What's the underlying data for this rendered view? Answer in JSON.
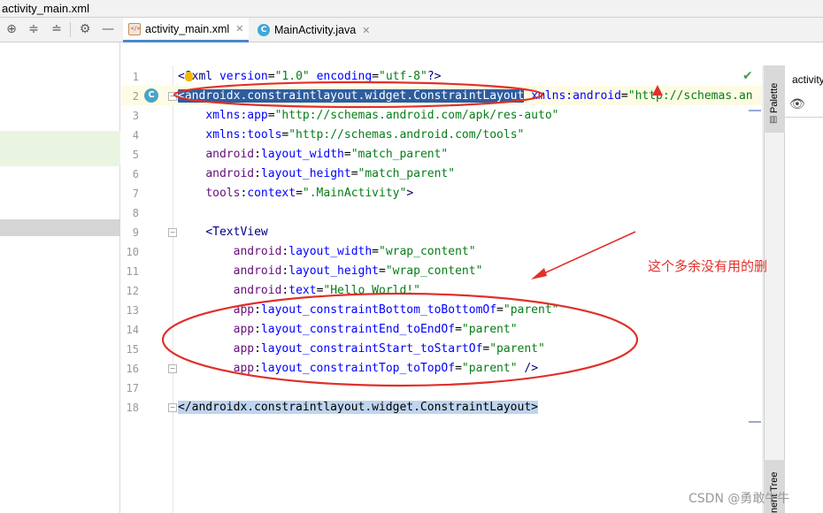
{
  "window": {
    "title": "activity_main.xml"
  },
  "tabs": [
    {
      "label": "activity_main.xml",
      "active": true
    },
    {
      "label": "MainActivity.java",
      "active": false
    }
  ],
  "toolbar_icons": [
    "crosshair-icon",
    "expand-all-icon",
    "collapse-all-icon",
    "gear-icon",
    "minimize-icon"
  ],
  "editor": {
    "line_numbers": [
      "1",
      "2",
      "3",
      "4",
      "5",
      "6",
      "7",
      "8",
      "9",
      "10",
      "11",
      "12",
      "13",
      "14",
      "15",
      "16",
      "17",
      "18"
    ],
    "lines": [
      [
        {
          "t": "<",
          "c": "tag"
        },
        {
          "t": "?",
          "c": "tag"
        },
        {
          "t": "xml ",
          "c": "tag"
        },
        {
          "t": "version",
          "c": "attr"
        },
        {
          "t": "=",
          "c": "plain"
        },
        {
          "t": "\"1.0\"",
          "c": "val"
        },
        {
          "t": " ",
          "c": "plain"
        },
        {
          "t": "encoding",
          "c": "attr"
        },
        {
          "t": "=",
          "c": "plain"
        },
        {
          "t": "\"utf-8\"",
          "c": "val"
        },
        {
          "t": "?>",
          "c": "tag"
        }
      ],
      [
        {
          "t": "<androidx.constraintlayout.widget.ConstraintLayout",
          "c": "sel"
        },
        {
          "t": " ",
          "c": "plain"
        },
        {
          "t": "xmlns:android",
          "c": "attr"
        },
        {
          "t": "=",
          "c": "plain"
        },
        {
          "t": "\"http://schemas.an",
          "c": "val"
        }
      ],
      [
        {
          "t": "    ",
          "c": "plain"
        },
        {
          "t": "xmlns:app",
          "c": "attr"
        },
        {
          "t": "=",
          "c": "plain"
        },
        {
          "t": "\"http://schemas.android.com/apk/res-auto\"",
          "c": "val"
        }
      ],
      [
        {
          "t": "    ",
          "c": "plain"
        },
        {
          "t": "xmlns:tools",
          "c": "attr"
        },
        {
          "t": "=",
          "c": "plain"
        },
        {
          "t": "\"http://schemas.android.com/tools\"",
          "c": "val"
        }
      ],
      [
        {
          "t": "    ",
          "c": "plain"
        },
        {
          "t": "android",
          "c": "ns"
        },
        {
          "t": ":",
          "c": "plain"
        },
        {
          "t": "layout_width",
          "c": "attr"
        },
        {
          "t": "=",
          "c": "plain"
        },
        {
          "t": "\"match_parent\"",
          "c": "val"
        }
      ],
      [
        {
          "t": "    ",
          "c": "plain"
        },
        {
          "t": "android",
          "c": "ns"
        },
        {
          "t": ":",
          "c": "plain"
        },
        {
          "t": "layout_height",
          "c": "attr"
        },
        {
          "t": "=",
          "c": "plain"
        },
        {
          "t": "\"match_parent\"",
          "c": "val"
        }
      ],
      [
        {
          "t": "    ",
          "c": "plain"
        },
        {
          "t": "tools",
          "c": "ns"
        },
        {
          "t": ":",
          "c": "plain"
        },
        {
          "t": "context",
          "c": "attr"
        },
        {
          "t": "=",
          "c": "plain"
        },
        {
          "t": "\".MainActivity\"",
          "c": "val"
        },
        {
          "t": ">",
          "c": "tag"
        }
      ],
      [],
      [
        {
          "t": "    ",
          "c": "plain"
        },
        {
          "t": "<TextView",
          "c": "tag"
        }
      ],
      [
        {
          "t": "        ",
          "c": "plain"
        },
        {
          "t": "android",
          "c": "ns"
        },
        {
          "t": ":",
          "c": "plain"
        },
        {
          "t": "layout_width",
          "c": "attr"
        },
        {
          "t": "=",
          "c": "plain"
        },
        {
          "t": "\"wrap_content\"",
          "c": "val"
        }
      ],
      [
        {
          "t": "        ",
          "c": "plain"
        },
        {
          "t": "android",
          "c": "ns"
        },
        {
          "t": ":",
          "c": "plain"
        },
        {
          "t": "layout_height",
          "c": "attr"
        },
        {
          "t": "=",
          "c": "plain"
        },
        {
          "t": "\"wrap_content\"",
          "c": "val"
        }
      ],
      [
        {
          "t": "        ",
          "c": "plain"
        },
        {
          "t": "android",
          "c": "ns"
        },
        {
          "t": ":",
          "c": "plain"
        },
        {
          "t": "text",
          "c": "attr"
        },
        {
          "t": "=",
          "c": "plain"
        },
        {
          "t": "\"Hello World!\"",
          "c": "val"
        }
      ],
      [
        {
          "t": "        ",
          "c": "plain"
        },
        {
          "t": "app",
          "c": "ns"
        },
        {
          "t": ":",
          "c": "plain"
        },
        {
          "t": "layout_constraintBottom_toBottomOf",
          "c": "attr"
        },
        {
          "t": "=",
          "c": "plain"
        },
        {
          "t": "\"parent\"",
          "c": "val"
        }
      ],
      [
        {
          "t": "        ",
          "c": "plain"
        },
        {
          "t": "app",
          "c": "ns"
        },
        {
          "t": ":",
          "c": "plain"
        },
        {
          "t": "layout_constraintEnd_toEndOf",
          "c": "attr"
        },
        {
          "t": "=",
          "c": "plain"
        },
        {
          "t": "\"parent\"",
          "c": "val"
        }
      ],
      [
        {
          "t": "        ",
          "c": "plain"
        },
        {
          "t": "app",
          "c": "ns"
        },
        {
          "t": ":",
          "c": "plain"
        },
        {
          "t": "layout_constraintStart_toStartOf",
          "c": "attr"
        },
        {
          "t": "=",
          "c": "plain"
        },
        {
          "t": "\"parent\"",
          "c": "val"
        }
      ],
      [
        {
          "t": "        ",
          "c": "plain"
        },
        {
          "t": "app",
          "c": "ns"
        },
        {
          "t": ":",
          "c": "plain"
        },
        {
          "t": "layout_constraintTop_toTopOf",
          "c": "attr"
        },
        {
          "t": "=",
          "c": "plain"
        },
        {
          "t": "\"parent\"",
          "c": "val"
        },
        {
          "t": " />",
          "c": "tag"
        }
      ],
      [],
      [
        {
          "t": "</androidx.constraintlayout.widget.ConstraintLayout>",
          "c": "sel2"
        }
      ]
    ]
  },
  "right_panel": {
    "palette_label": "Palette",
    "component_tree_label": "nent Tree",
    "title": "activity"
  },
  "annotation": {
    "note": "这个多余没有用的删",
    "color": "#e0302a"
  },
  "watermark": "CSDN @勇敢牛牛"
}
